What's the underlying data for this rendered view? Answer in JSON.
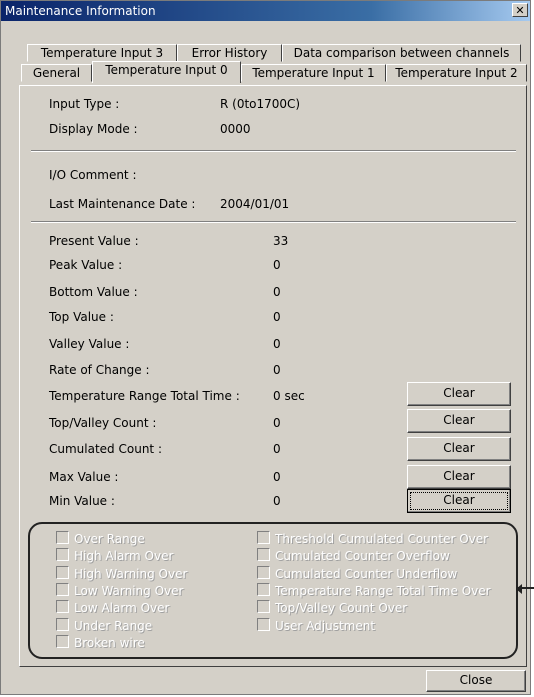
{
  "window": {
    "title": "Maintenance Information",
    "close_glyph": "✕"
  },
  "tabs": {
    "row1": [
      "Temperature Input 3",
      "Error History",
      "Data comparison between channels"
    ],
    "row2": [
      "General",
      "Temperature Input 0",
      "Temperature Input 1",
      "Temperature Input 2"
    ],
    "active": "Temperature Input 0"
  },
  "info": {
    "input_type_label": "Input Type :",
    "input_type_value": "R (0to1700C)",
    "display_mode_label": "Display Mode :",
    "display_mode_value": "0000",
    "io_comment_label": "I/O Comment :",
    "last_maint_label": "Last Maintenance Date :",
    "last_maint_value": "2004/01/01"
  },
  "values": [
    {
      "label": "Present Value :",
      "value": "33"
    },
    {
      "label": "Peak Value :",
      "value": "0"
    },
    {
      "label": "Bottom Value :",
      "value": "0"
    },
    {
      "label": "Top Value :",
      "value": "0"
    },
    {
      "label": "Valley Value :",
      "value": "0"
    },
    {
      "label": "Rate of Change :",
      "value": "0"
    },
    {
      "label": "Temperature Range Total Time :",
      "value": "0 sec",
      "button": "Clear"
    },
    {
      "label": "Top/Valley Count :",
      "value": "0",
      "button": "Clear"
    },
    {
      "label": "Cumulated Count :",
      "value": "0",
      "button": "Clear"
    },
    {
      "label": "Max Value :",
      "value": "0",
      "button": "Clear"
    },
    {
      "label": "Min Value :",
      "value": "0",
      "button": "Clear"
    }
  ],
  "status_left": [
    "Over Range",
    "High Alarm Over",
    "High Warning Over",
    "Low Warning Over",
    "Low Alarm Over",
    "Under Range",
    "Broken wire"
  ],
  "status_right": [
    "Threshold Cumulated Counter Over",
    "Cumulated Counter Overflow",
    "Cumulated Counter Underflow",
    "Temperature Range Total Time Over",
    "Top/Valley Count Over",
    "User Adjustment"
  ],
  "footer": {
    "close_label": "Close"
  }
}
